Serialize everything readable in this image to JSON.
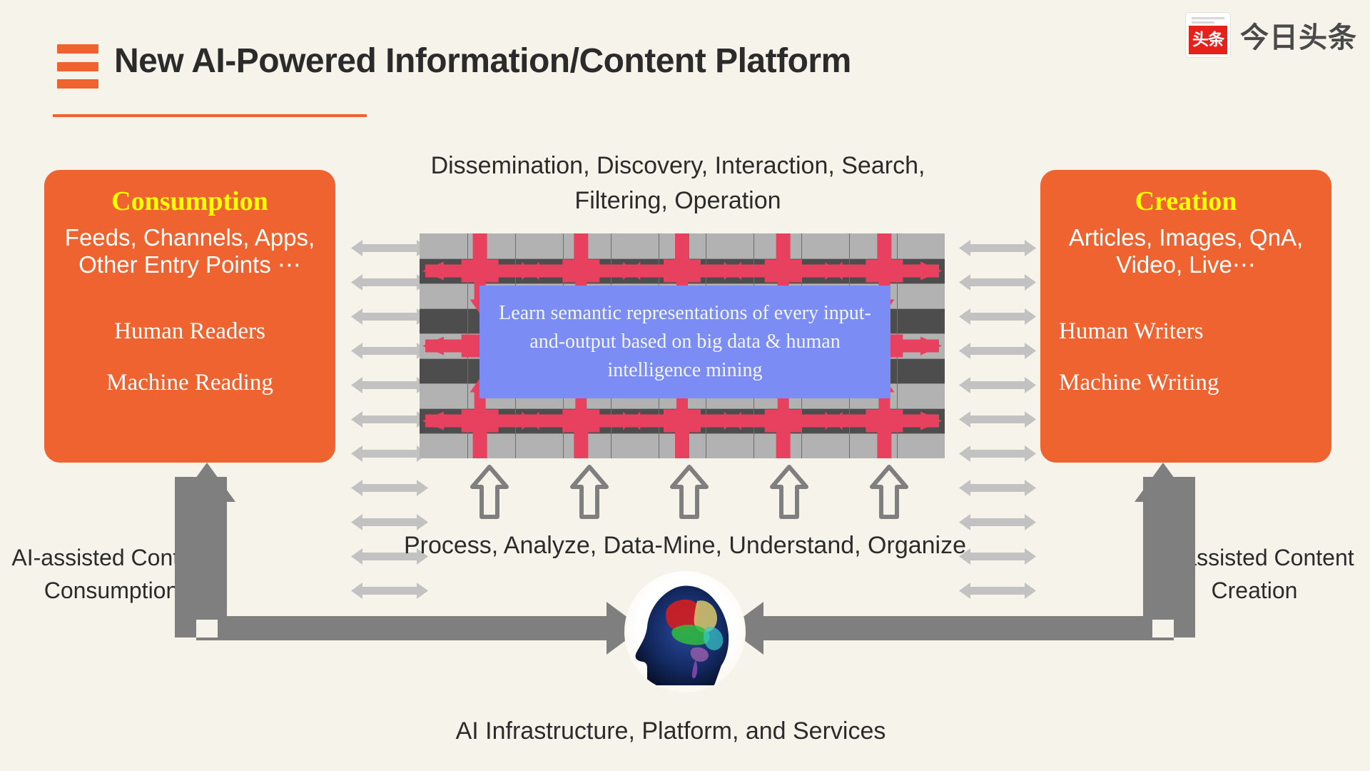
{
  "header": {
    "title": "New AI-Powered Information/Content Platform",
    "menu_icon": "hamburger-icon",
    "accent_color": "#ef6331"
  },
  "logo": {
    "badge_text": "头条",
    "wordmark": "今日头条",
    "badge_color": "#e8201b"
  },
  "panels": {
    "left": {
      "title": "Consumption",
      "list": "Feeds, Channels, Apps, Other Entry Points ⋯",
      "sub_first": "Human Readers",
      "sub_second": "Machine Reading",
      "bg_color": "#ef6331",
      "title_color": "#ffff00"
    },
    "right": {
      "title": "Creation",
      "list": "Articles, Images, QnA, Video, Live⋯",
      "sub_first": "Human Writers",
      "sub_second": "Machine Writing",
      "bg_color": "#ef6331",
      "title_color": "#ffff00"
    }
  },
  "center": {
    "callout": "Learn semantic representations of every input-and-output based on big data & human intelligence mining",
    "callout_color": "#7b8cf4",
    "grid_arrow_color": "#e8415f"
  },
  "captions": {
    "top": "Dissemination, Discovery, Interaction, Search, Filtering, Operation",
    "middle": "Process, Analyze, Data-Mine, Understand, Organize",
    "bottom": "AI Infrastructure, Platform, and Services",
    "side_left": "AI-assisted Content Consumption",
    "side_right": "AI-assisted Content Creation"
  },
  "icons": {
    "brain": "brain-head-icon",
    "connector": "double-headed-arrow-icon",
    "uplift": "hollow-up-arrow-icon",
    "flow": "thick-gray-arrow-icon"
  },
  "counts": {
    "connector_arrows_per_side": 11,
    "hollow_up_arrows": 5,
    "grid_columns": 11,
    "grid_bands": 9
  }
}
